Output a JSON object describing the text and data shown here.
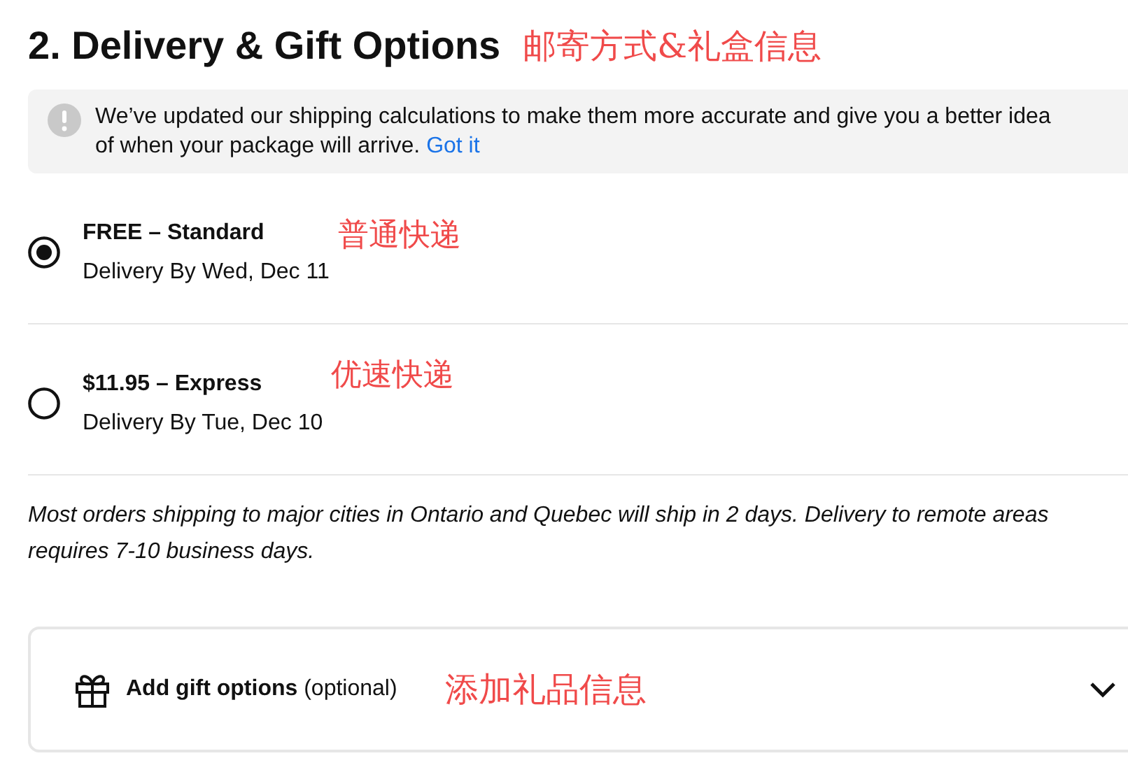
{
  "heading": {
    "title": "2. Delivery & Gift Options",
    "annotation": "邮寄方式&礼盒信息"
  },
  "notice": {
    "text": "We’ve updated our shipping calculations to make them more accurate and give you a better idea of when your package will arrive.",
    "link": "Got it"
  },
  "options": [
    {
      "title": "FREE – Standard",
      "delivery": "Delivery By Wed, Dec 11",
      "annotation": "普通快递",
      "selected": true
    },
    {
      "title": "$11.95 – Express",
      "delivery": "Delivery By Tue, Dec 10",
      "annotation": "优速快递",
      "selected": false
    }
  ],
  "note": "Most orders shipping to major cities in Ontario and Quebec will ship in 2 days. Delivery to remote areas requires 7-10 business days.",
  "gift": {
    "label": "Add gift options",
    "suffix": "(optional)",
    "annotation": "添加礼品信息",
    "expanded": false
  }
}
